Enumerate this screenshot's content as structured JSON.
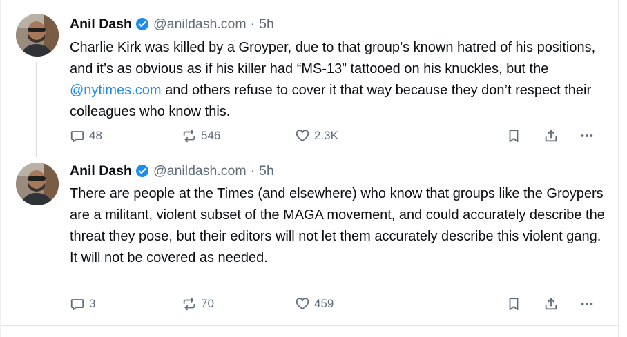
{
  "posts": [
    {
      "author": {
        "name": "Anil Dash",
        "handle": "@anildash.com",
        "verified": true
      },
      "separator": "·",
      "time": "5h",
      "text_parts": {
        "before": "Charlie Kirk was killed by a Groyper, due to that group’s known hatred of his positions, and it’s as obvious as if his killer had “MS-13” tattooed on his knuckles, but the ",
        "mention": "@nytimes.com",
        "after": " and others refuse to cover it that way because they don’t respect their colleagues who know this."
      },
      "counts": {
        "replies": "48",
        "reposts": "546",
        "likes": "2.3K"
      }
    },
    {
      "author": {
        "name": "Anil Dash",
        "handle": "@anildash.com",
        "verified": true
      },
      "separator": "·",
      "time": "5h",
      "text": "There are people at the Times (and elsewhere) who know that groups like the Groypers are a militant, violent subset of the MAGA movement, and could accurately describe the threat they pose, but their editors will not let them accurately describe this violent gang. It will not be covered as needed.",
      "counts": {
        "replies": "3",
        "reposts": "70",
        "likes": "459"
      }
    }
  ],
  "icons": {
    "reply": "reply-icon",
    "repost": "repost-icon",
    "like": "like-icon",
    "bookmark": "bookmark-icon",
    "share": "share-icon",
    "more": "more-icon",
    "verified": "verified-badge-icon"
  },
  "colors": {
    "text": "#0b0f14",
    "secondary": "#5f6c79",
    "link": "#1d8cf0",
    "verified": "#1d8cf0",
    "divider": "#e2e6ea"
  }
}
